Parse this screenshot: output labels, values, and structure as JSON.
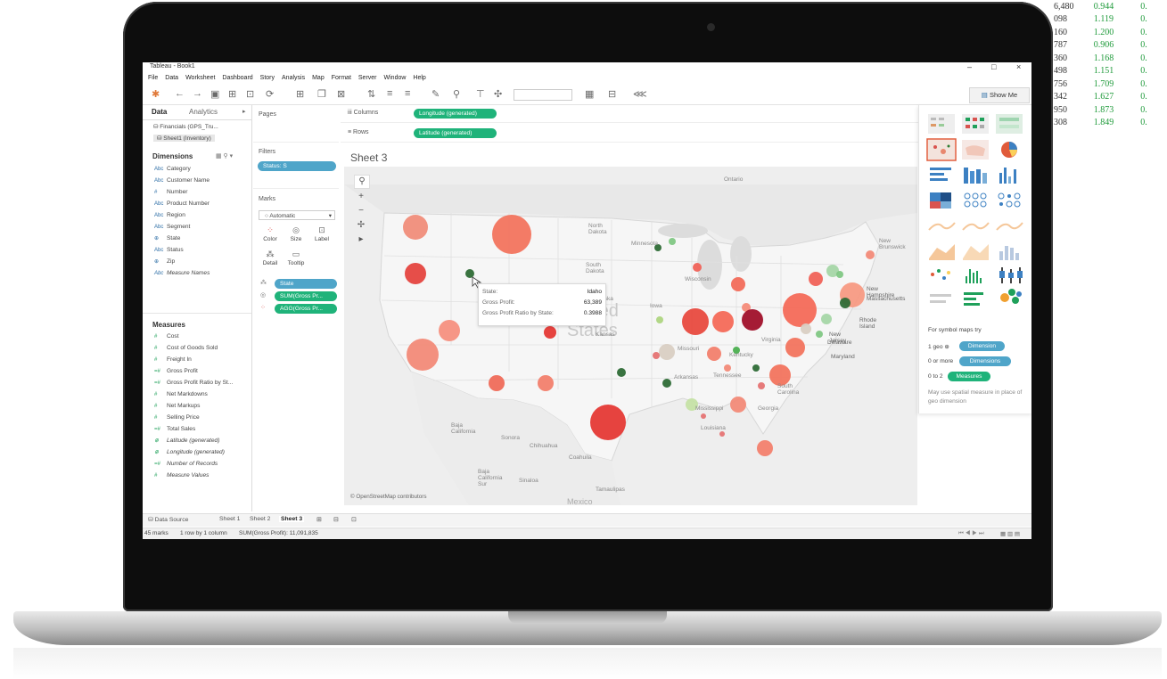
{
  "background_sheet": {
    "rows": [
      {
        "a": "6,480",
        "b": "0.944",
        "c": "0."
      },
      {
        "a": "098",
        "b": "1.119",
        "c": "0."
      },
      {
        "a": "160",
        "b": "1.200",
        "c": "0."
      },
      {
        "a": "787",
        "b": "0.906",
        "c": "0."
      },
      {
        "a": "360",
        "b": "1.168",
        "c": "0."
      },
      {
        "a": "498",
        "b": "1.151",
        "c": "0."
      },
      {
        "a": "756",
        "b": "1.709",
        "c": "0."
      },
      {
        "a": "342",
        "b": "1.627",
        "c": "0."
      },
      {
        "a": "950",
        "b": "1.873",
        "c": "0."
      },
      {
        "a": "308",
        "b": "1.849",
        "c": "0."
      }
    ]
  },
  "window": {
    "title": "Tableau - Book1",
    "controls": {
      "min": "–",
      "max": "□",
      "close": "×"
    }
  },
  "menu": [
    "File",
    "Data",
    "Worksheet",
    "Dashboard",
    "Story",
    "Analysis",
    "Map",
    "Format",
    "Server",
    "Window",
    "Help"
  ],
  "toolbar": {
    "show_me_label": "Show Me"
  },
  "data_pane": {
    "tab_data": "Data",
    "tab_analytics": "Analytics",
    "sources": [
      "Financials (GPS_Tru...",
      "Sheet1 (Inventory)"
    ],
    "dimensions_header": "Dimensions",
    "dimensions": [
      {
        "type": "Abc",
        "name": "Category"
      },
      {
        "type": "Abc",
        "name": "Customer Name"
      },
      {
        "type": "#",
        "name": "Number"
      },
      {
        "type": "Abc",
        "name": "Product Number"
      },
      {
        "type": "Abc",
        "name": "Region"
      },
      {
        "type": "Abc",
        "name": "Segment"
      },
      {
        "type": "⊕",
        "name": "State"
      },
      {
        "type": "Abc",
        "name": "Status"
      },
      {
        "type": "⊕",
        "name": "Zip"
      },
      {
        "type": "Abc",
        "name": "Measure Names"
      }
    ],
    "measures_header": "Measures",
    "measures": [
      {
        "type": "#",
        "name": "Cost"
      },
      {
        "type": "#",
        "name": "Cost of Goods Sold"
      },
      {
        "type": "#",
        "name": "Freight In"
      },
      {
        "type": "=#",
        "name": "Gross Profit"
      },
      {
        "type": "=#",
        "name": "Gross Profit Ratio by St..."
      },
      {
        "type": "#",
        "name": "Net Markdowns"
      },
      {
        "type": "#",
        "name": "Net Markups"
      },
      {
        "type": "#",
        "name": "Selling Price"
      },
      {
        "type": "=#",
        "name": "Total Sales"
      },
      {
        "type": "⊕",
        "name": "Latitude (generated)"
      },
      {
        "type": "⊕",
        "name": "Longitude (generated)"
      },
      {
        "type": "=#",
        "name": "Number of Records"
      },
      {
        "type": "#",
        "name": "Measure Values"
      }
    ]
  },
  "shelves": {
    "pages_label": "Pages",
    "filters_label": "Filters",
    "filter_pill": "Status: S",
    "marks_label": "Marks",
    "mark_type": "Automatic",
    "mark_buttons": [
      "Color",
      "Size",
      "Label",
      "Detail",
      "Tooltip"
    ],
    "mark_pills": [
      "State",
      "SUM(Gross Pr...",
      "AGG(Gross Pr..."
    ],
    "columns_label": "Columns",
    "columns_pill": "Longitude (generated)",
    "rows_label": "Rows",
    "rows_pill": "Latitude (generated)"
  },
  "sheet": {
    "title": "Sheet 3",
    "attribution": "© OpenStreetMap contributors",
    "map_labels": [
      {
        "text": "Ontario"
      },
      {
        "text": "North Dakota"
      },
      {
        "text": "South Dakota"
      },
      {
        "text": "Wisconsin"
      },
      {
        "text": "Minnesota"
      },
      {
        "text": "New Brunswick"
      },
      {
        "text": "New Hampshire"
      },
      {
        "text": "Massachusetts"
      },
      {
        "text": "Rhode Island"
      },
      {
        "text": "New Jersey"
      },
      {
        "text": "Delaware"
      },
      {
        "text": "Maryland"
      },
      {
        "text": "Virginia"
      },
      {
        "text": "Iowa"
      },
      {
        "text": "Missouri"
      },
      {
        "text": "Kentucky"
      },
      {
        "text": "Tennessee"
      },
      {
        "text": "Georgia"
      },
      {
        "text": "South Carolina"
      },
      {
        "text": "Arkansas"
      },
      {
        "text": "Mississippi"
      },
      {
        "text": "Louisiana"
      },
      {
        "text": "Baja California"
      },
      {
        "text": "Sonora"
      },
      {
        "text": "Chihuahua"
      },
      {
        "text": "Coahuila"
      },
      {
        "text": "Baja California Sur"
      },
      {
        "text": "Sinaloa"
      },
      {
        "text": "Tamaulipas"
      },
      {
        "text": "Mexico"
      },
      {
        "text": "United States"
      },
      {
        "text": "Kansas"
      },
      {
        "text": "Nebraska"
      }
    ]
  },
  "tooltip": {
    "rows": [
      {
        "k": "State:",
        "v": "Idaho"
      },
      {
        "k": "Gross Profit:",
        "v": "63,389"
      },
      {
        "k": "Gross Profit Ratio by State:",
        "v": "0.3988"
      }
    ]
  },
  "show_me": {
    "for_text": "For symbol maps try",
    "req1_label": "1 geo",
    "req1_pill": "Dimension",
    "req2_label": "0 or more",
    "req2_pill": "Dimensions",
    "req3_label": "0 to 2",
    "req3_pill": "Measures",
    "note": "May use spatial measure in place of geo dimension"
  },
  "sheet_tabs": {
    "data_source": "Data Source",
    "tabs": [
      "Sheet 1",
      "Sheet 2",
      "Sheet 3"
    ]
  },
  "status": {
    "marks": "45 marks",
    "rows_cols": "1 row by 1 column",
    "sum": "SUM(Gross Profit): 11,091,835"
  },
  "colors": {
    "accent_green": "#1fb37a",
    "accent_blue": "#4fa5c9",
    "positive": "#2e7d32",
    "negative": "#d93a36"
  }
}
